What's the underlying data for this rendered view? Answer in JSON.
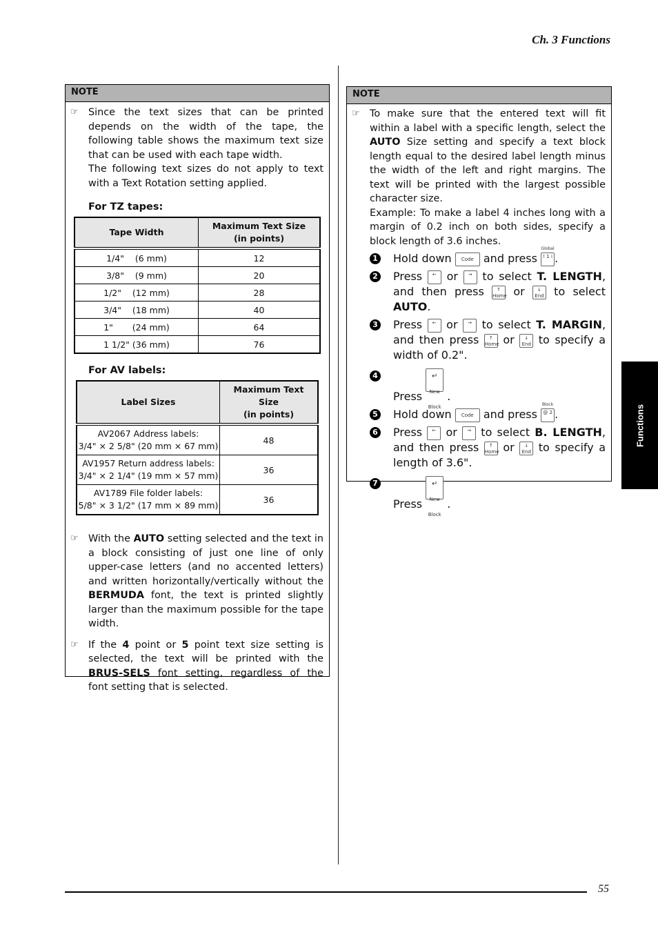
{
  "header": {
    "chapter": "Ch. 3 Functions"
  },
  "side_tab": {
    "label": "Functions"
  },
  "footer": {
    "page_number": "55"
  },
  "left_note": {
    "title": "NOTE",
    "bullet_icon": "pointing-hand-icon",
    "intro_p1": "Since the text sizes that can be printed depends on the width of the tape, the following table shows the maximum text size that can be used with each tape width.",
    "intro_p2": "The following text sizes do not apply to text with a Text Rotation setting applied.",
    "tz": {
      "heading": "For TZ tapes:",
      "headers": [
        "Tape Width",
        "Maximum Text Size\n(in points)"
      ],
      "rows": [
        [
          "1/4\"    (6 mm)",
          "12"
        ],
        [
          "3/8\"    (9 mm)",
          "20"
        ],
        [
          "1/2\"    (12 mm)",
          "28"
        ],
        [
          "3/4\"    (18 mm)",
          "40"
        ],
        [
          "1\"       (24 mm)",
          "64"
        ],
        [
          "1 1/2\" (36 mm)",
          "76"
        ]
      ]
    },
    "av": {
      "heading": "For AV labels:",
      "headers": [
        "Label Sizes",
        "Maximum Text Size\n(in points)"
      ],
      "rows": [
        [
          "AV2067 Address labels:",
          "3/4\" × 2 5/8\" (20 mm × 67 mm)",
          "48"
        ],
        [
          "AV1957 Return address labels:",
          "3/4\" × 2 1/4\" (19 mm × 57 mm)",
          "36"
        ],
        [
          "AV1789 File folder labels:",
          "5/8\" × 3 1/2\" (17 mm × 89 mm)",
          "36"
        ]
      ]
    },
    "bullet2": {
      "a": "With the ",
      "b1": "AUTO",
      "c": " setting selected and the text in a block consisting of just one line of only upper-case letters (and no accented letters) and written horizontally/vertically without the ",
      "b2": "BERMUDA",
      "d": " font, the text is printed slightly larger than the maximum possible for the tape width."
    },
    "bullet3": {
      "a": "If the ",
      "b1": "4",
      "c": " point or ",
      "b2": "5",
      "d": " point text size setting is selected, the text will be printed with the ",
      "b3": "BRUS-SELS",
      "e": " font setting, regardless of the font setting that is selected."
    }
  },
  "right_note": {
    "title": "NOTE",
    "p1a": "To make sure that the entered text will fit within a label with a specific length, select the ",
    "p1b": "AUTO",
    "p1c": " Size setting and specify a text block length equal to the desired label length minus the width of the left and right margins. The text will be printed with the largest possible character size.",
    "p2": "Example: To make a label 4 inches long with a margin of 0.2 inch on both sides, specify a block length of 3.6 inches.",
    "keys": {
      "code": "Code",
      "global": "Global",
      "global_key": "! 1 i",
      "home": "Home",
      "end": "End",
      "new_block": "New Block",
      "block": "Block",
      "block_key": "@ 2",
      "left": "←",
      "right": "→",
      "up": "↑",
      "down": "↓",
      "enter": "↵"
    },
    "steps": [
      {
        "n": "1",
        "a": "Hold down",
        "b": "and press",
        "c": "."
      },
      {
        "n": "2",
        "a": "Press",
        "or": "or",
        "b": "to select",
        "bold1": "T. LENGTH",
        "c": ", and then press",
        "d": "to select",
        "bold2": "AUTO",
        "e": "."
      },
      {
        "n": "3",
        "a": "Press",
        "or": "or",
        "b": "to select",
        "bold1": "T. MARGIN",
        "c": ", and then press",
        "d": "to specify a width of 0.2\"."
      },
      {
        "n": "4",
        "a": "Press",
        "c": "."
      },
      {
        "n": "5",
        "a": "Hold down",
        "b": "and press",
        "c": "."
      },
      {
        "n": "6",
        "a": "Press",
        "or": "or",
        "b": "to select",
        "bold1": "B. LENGTH",
        "c": ", and then press",
        "d": "to specify a length of 3.6\"."
      },
      {
        "n": "7",
        "a": "Press",
        "c": "."
      }
    ]
  }
}
